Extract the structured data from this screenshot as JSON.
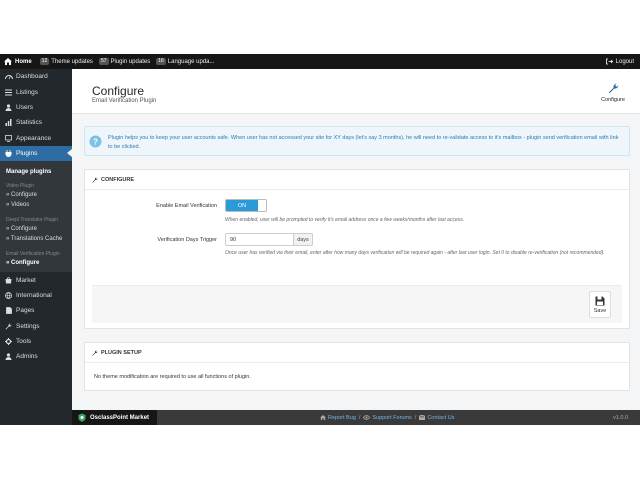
{
  "topbar": {
    "home_label": "Home",
    "theme_updates_count": "12",
    "theme_updates_label": "Theme updates",
    "plugin_updates_count": "57",
    "plugin_updates_label": "Plugin updates",
    "language_updates_count": "16",
    "language_updates_label": "Language upda...",
    "logout_label": "Logout"
  },
  "sidebar": {
    "items": [
      {
        "label": "Dashboard",
        "icon": "dashboard-icon"
      },
      {
        "label": "Listings",
        "icon": "listings-icon"
      },
      {
        "label": "Users",
        "icon": "users-icon"
      },
      {
        "label": "Statistics",
        "icon": "statistics-icon"
      },
      {
        "label": "Appearance",
        "icon": "appearance-icon"
      },
      {
        "label": "Plugins",
        "icon": "plugins-icon"
      },
      {
        "label": "Market",
        "icon": "market-icon"
      },
      {
        "label": "International",
        "icon": "globe-icon"
      },
      {
        "label": "Pages",
        "icon": "pages-icon"
      },
      {
        "label": "Settings",
        "icon": "wrench-icon"
      },
      {
        "label": "Tools",
        "icon": "tools-icon"
      },
      {
        "label": "Admins",
        "icon": "admins-icon"
      }
    ],
    "submenu": {
      "manage_plugins": "Manage plugins",
      "group_video": "Video Plugin",
      "video_configure": "» Configure",
      "video_videos": "» Videos",
      "group_deepl": "Deepl Translator Plugin",
      "deepl_configure": "» Configure",
      "deepl_cache": "» Translations Cache",
      "group_email": "Email Verification Plugin",
      "email_configure": "» Configure"
    }
  },
  "header": {
    "title": "Configure",
    "subtitle": "Email Verification Plugin",
    "configure_label": "Configure"
  },
  "info": {
    "text": "Plugin helps you to keep your user accounts safe. When user has not accessed your site for XY days (let's say 3 months), he will need to re-validate access to it's mailbox - plugin send verification email with link to be clicked."
  },
  "configure_panel": {
    "heading": "CONFIGURE",
    "enable_label": "Enable Email Verification",
    "toggle_state": "ON",
    "enable_help": "When enabled, user will be prompted to verify it's email address once a few weeks/months after last access.",
    "days_label": "Verification Days Trigger",
    "days_value": "90",
    "days_unit": "days",
    "days_help": "Once user has verified via their email, enter after how many days verification will be required again - after last user login. Set 0 to disable re-verification (not recommended).",
    "save_label": "Save"
  },
  "setup_panel": {
    "heading": "PLUGIN SETUP",
    "text": "No theme modification are required to use all functions of plugin."
  },
  "footer": {
    "brand": "OsclassPoint Market",
    "report_bug": "Report Bug",
    "support_forums": "Support Forums",
    "contact_us": "Contact Us",
    "sep": "/",
    "version": "v1.0.0"
  },
  "colors": {
    "sidebar_bg": "#23282d",
    "active_nav": "#2e6da4",
    "toggle_on": "#2a9bd7",
    "info_text": "#2a7ab0"
  }
}
